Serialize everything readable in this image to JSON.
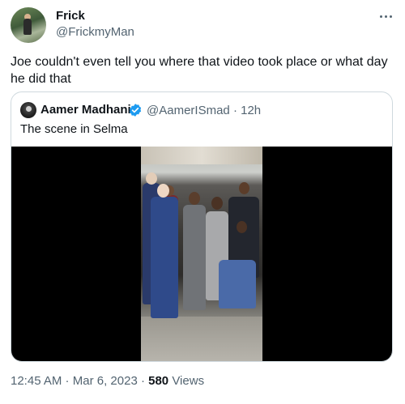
{
  "author": {
    "name": "Frick",
    "handle": "@FrickmyMan"
  },
  "tweet_text": "Joe couldn't even tell you where that video took place or what day he did that",
  "quoted": {
    "name": "Aamer Madhani",
    "handle": "@AamerISmad",
    "time": "· 12h",
    "text": "The scene in Selma"
  },
  "meta": {
    "time": "12:45 AM",
    "sep1": " · ",
    "date": "Mar 6, 2023",
    "sep2": " · ",
    "views_count": "580",
    "views_label": "Views"
  },
  "colors": {
    "text": "#0f1419",
    "secondary": "#536471",
    "border": "#cfd9de",
    "verified": "#1d9bf0"
  },
  "icons": {
    "more": "more-horizontal-icon",
    "verified": "verified-badge-icon"
  }
}
